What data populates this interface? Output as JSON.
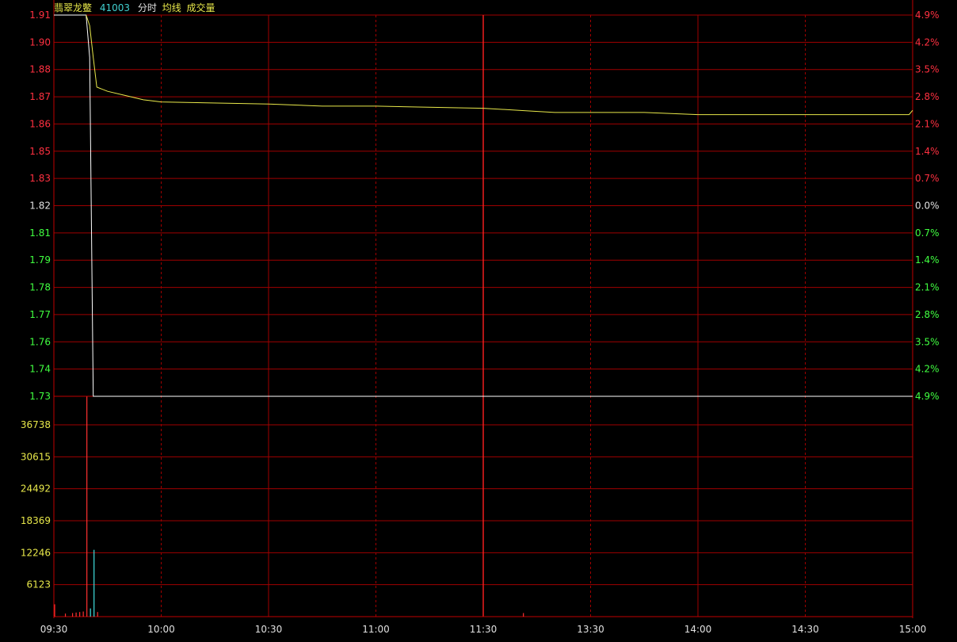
{
  "header": {
    "stock_name": "翡翠龙鳖",
    "stock_code": "41003",
    "label_timeshare": "分时",
    "label_avg": "均线",
    "label_volume": "成交量"
  },
  "colors": {
    "background": "#000000",
    "grid": "#a00000",
    "axis": "#c00000",
    "price_line": "#ffffff",
    "avg_line": "#e8e84a",
    "up": "#ff3040",
    "down": "#40ff40",
    "flat": "#e0e0e0",
    "volume_axis": "#e8e84a",
    "time_label": "#e0e0e0",
    "volume_bar_up": "#ff3030",
    "volume_bar_down": "#40e0e0",
    "code_color": "#40d0d0",
    "name_color": "#e8e84a"
  },
  "chart_data": {
    "type": "line",
    "title": "",
    "xlabel": "",
    "ylabel": "",
    "x_ticks": [
      "09:30",
      "10:00",
      "10:30",
      "11:00",
      "11:30",
      "13:30",
      "14:00",
      "14:30",
      "15:00"
    ],
    "price_axis": {
      "ylim": [
        1.73,
        1.91
      ],
      "prev_close": 1.82,
      "labels": [
        "1.91",
        "1.90",
        "1.88",
        "1.87",
        "1.86",
        "1.85",
        "1.83",
        "1.82",
        "1.81",
        "1.79",
        "1.78",
        "1.77",
        "1.76",
        "1.74",
        "1.73"
      ],
      "pct_labels": [
        "4.9%",
        "4.2%",
        "3.5%",
        "2.8%",
        "2.1%",
        "1.4%",
        "0.7%",
        "0.0%",
        "0.7%",
        "1.4%",
        "2.1%",
        "2.8%",
        "3.5%",
        "4.2%",
        "4.9%"
      ]
    },
    "volume_axis": {
      "ylim": [
        0,
        42861
      ],
      "labels": [
        "36738",
        "30615",
        "24492",
        "18369",
        "12246",
        "6123"
      ]
    },
    "series": [
      {
        "key": "price",
        "minute": [
          0,
          9,
          10,
          11,
          240
        ],
        "values": [
          1.91,
          1.91,
          1.89,
          1.73,
          1.73
        ]
      },
      {
        "key": "avg",
        "minute": [
          9,
          10,
          11,
          12,
          15,
          20,
          25,
          30,
          60,
          75,
          90,
          120,
          130,
          140,
          150,
          165,
          180,
          200,
          220,
          239,
          240
        ],
        "values": [
          1.91,
          1.905,
          1.89,
          1.876,
          1.874,
          1.872,
          1.87,
          1.869,
          1.868,
          1.867,
          1.867,
          1.866,
          1.865,
          1.864,
          1.864,
          1.864,
          1.863,
          1.863,
          1.863,
          1.863,
          1.865
        ]
      }
    ],
    "volume": [
      {
        "minute": 0,
        "value": 2400,
        "dir": "up"
      },
      {
        "minute": 3,
        "value": 600,
        "dir": "up"
      },
      {
        "minute": 5,
        "value": 700,
        "dir": "up"
      },
      {
        "minute": 6,
        "value": 800,
        "dir": "up"
      },
      {
        "minute": 7,
        "value": 900,
        "dir": "up"
      },
      {
        "minute": 8,
        "value": 1000,
        "dir": "up"
      },
      {
        "minute": 9,
        "value": 42800,
        "dir": "up"
      },
      {
        "minute": 10,
        "value": 1600,
        "dir": "down"
      },
      {
        "minute": 11,
        "value": 13000,
        "dir": "down"
      },
      {
        "minute": 12,
        "value": 900,
        "dir": "up"
      },
      {
        "minute": 131,
        "value": 700,
        "dir": "up"
      }
    ]
  }
}
